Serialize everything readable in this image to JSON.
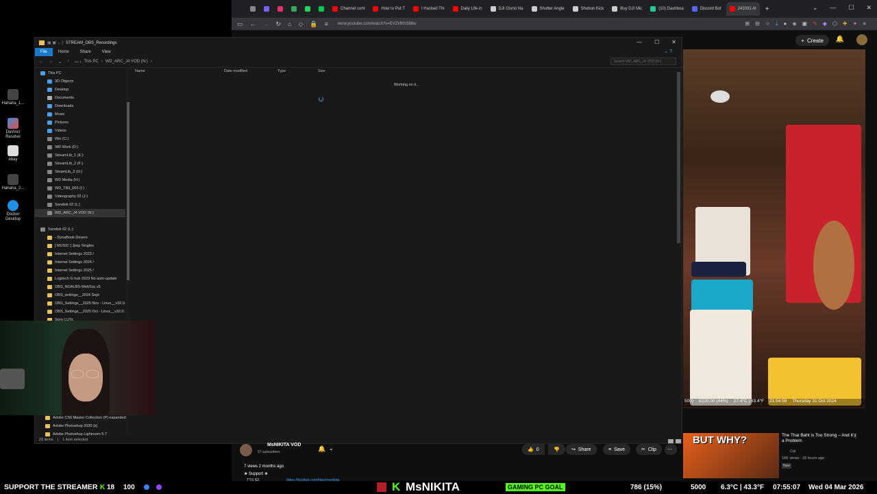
{
  "desktop": {
    "icons": [
      {
        "label": "Hahaha_1..."
      },
      {
        "label": "DaVinci Resolve"
      },
      {
        "label": "ebay"
      },
      {
        "label": "Hahaha_2..."
      },
      {
        "label": "Docker Desktop"
      }
    ]
  },
  "browser": {
    "tabs": [
      {
        "label": "",
        "color": "#888"
      },
      {
        "label": "",
        "color": "#7c5cff"
      },
      {
        "label": "",
        "color": "#e1306c"
      },
      {
        "label": "",
        "color": "#34a853"
      },
      {
        "label": "",
        "color": "#1ed760"
      },
      {
        "label": "",
        "color": "#00c853"
      },
      {
        "label": "Channel cont",
        "color": "#ff0000"
      },
      {
        "label": "How to Put T",
        "color": "#ff0000"
      },
      {
        "label": "I Hacked Thi",
        "color": "#ff0000"
      },
      {
        "label": "Daily Life in",
        "color": "#ff0000"
      },
      {
        "label": "DJI Osmo Na",
        "color": "#ccc"
      },
      {
        "label": "Shutter Angle",
        "color": "#ccc"
      },
      {
        "label": "Shobon Kick",
        "color": "#ccc"
      },
      {
        "label": "Buy DJI Mic",
        "color": "#ccc"
      },
      {
        "label": "(10) Dashboa",
        "color": "#20c997"
      },
      {
        "label": "Discord Bot",
        "color": "#5865f2"
      },
      {
        "label": "241031 At",
        "color": "#ff0000"
      }
    ],
    "url": "www.youtube.com/watch?v=EVZkfKhS86w",
    "create_label": "Create"
  },
  "explorer": {
    "title": "STREAM_OBS_Recordings",
    "ribbon": [
      "File",
      "Home",
      "Share",
      "View"
    ],
    "breadcrumb": [
      "This PC",
      "WD_ARC_J4 VOD (N:)"
    ],
    "search_placeholder": "Search WD_ARC_J4 VOD (N:)",
    "nav_items": [
      {
        "label": "This PC",
        "color": "#4a9fe8",
        "indent": 0
      },
      {
        "label": "3D Objects",
        "color": "#4a9fe8",
        "indent": 1
      },
      {
        "label": "Desktop",
        "color": "#4a9fe8",
        "indent": 1
      },
      {
        "label": "Documents",
        "color": "#aaa",
        "indent": 1
      },
      {
        "label": "Downloads",
        "color": "#4a9fe8",
        "indent": 1
      },
      {
        "label": "Music",
        "color": "#4a9fe8",
        "indent": 1
      },
      {
        "label": "Pictures",
        "color": "#4a9fe8",
        "indent": 1
      },
      {
        "label": "Videos",
        "color": "#4a9fe8",
        "indent": 1
      },
      {
        "label": "Win (C:)",
        "color": "#888",
        "indent": 1
      },
      {
        "label": "980 Work (D:)",
        "color": "#888",
        "indent": 1
      },
      {
        "label": "StreamLib_1 (E:)",
        "color": "#888",
        "indent": 1
      },
      {
        "label": "StreamLib_2 (F:)",
        "color": "#888",
        "indent": 1
      },
      {
        "label": "SteamLib_3 (G:)",
        "color": "#888",
        "indent": 1
      },
      {
        "label": "WD Media (H:)",
        "color": "#888",
        "indent": 1
      },
      {
        "label": "WD_TB3_003 (I:)",
        "color": "#888",
        "indent": 1
      },
      {
        "label": "Videography 02 (J:)",
        "color": "#888",
        "indent": 1
      },
      {
        "label": "Sandisk 02 (L:)",
        "color": "#888",
        "indent": 1
      },
      {
        "label": "WD_ARC_J4 VOD (N:)",
        "color": "#888",
        "indent": 1,
        "selected": true
      },
      {
        "label": "",
        "color": "",
        "indent": 0
      },
      {
        "label": "Sandisk 02 (L:)",
        "color": "#888",
        "indent": 0
      },
      {
        "label": "- DynaBook Drivers",
        "color": "#e8c15a",
        "indent": 1
      },
      {
        "label": "[ MUSIC ] Jpop Singles",
        "color": "#e8c15a",
        "indent": 1
      },
      {
        "label": "Internet Settings 2023 /",
        "color": "#e8c15a",
        "indent": 1
      },
      {
        "label": "Internet Settings 2024 /",
        "color": "#e8c15a",
        "indent": 1
      },
      {
        "label": "Internet Settings 2025 /",
        "color": "#e8c15a",
        "indent": 1
      },
      {
        "label": "Logitech G hub 2023 No auto-update",
        "color": "#e8c15a",
        "indent": 1
      },
      {
        "label": "OBS_NOALBS-WebSoc v5",
        "color": "#e8c15a",
        "indent": 1
      },
      {
        "label": "OBS_settings__2024 Sept",
        "color": "#e8c15a",
        "indent": 1
      },
      {
        "label": "OBS_Settings__2025 Nov - Linux__v32.0...",
        "color": "#e8c15a",
        "indent": 1
      },
      {
        "label": "OBS_Settings__2025 Oct - Linux__v32.0.1",
        "color": "#e8c15a",
        "indent": 1
      },
      {
        "label": "Sony LUTs",
        "color": "#e8c15a",
        "indent": 1
      }
    ],
    "nav_bottom": [
      {
        "label": "Adobe CS6 Master Collection (P) expanded",
        "color": "#e8c15a"
      },
      {
        "label": "Adobe Photoshop 2020 (k)",
        "color": "#e8c15a"
      },
      {
        "label": "Adobe Photoshop Lightroom 5.7",
        "color": "#e8c15a"
      }
    ],
    "columns": [
      "Name",
      "Date modified",
      "Type",
      "Size"
    ],
    "working": "Working on it...",
    "status_items": "23 items",
    "status_selected": "1 item selected"
  },
  "video_overlay": {
    "left": "500)",
    "amount": "£220.00 (44%)",
    "temp": "17.4°C | 63.4°F",
    "time": "21:54:59",
    "date": "Thursday 31 Oct 2024"
  },
  "youtube": {
    "channel": "MsNIKITA VOD",
    "subscribers": "57 subscribers",
    "likes": "0",
    "share": "Share",
    "save": "Save",
    "clip": "Clip",
    "views": "7 views  2 months ago",
    "support": "★ Support ★",
    "tts": "TTS $3",
    "link": "https://kickbot.com/tips/msnikita",
    "rec_title": "The Thai Baht is Too Strong – And it's a Problem",
    "rec_channel": "Cal",
    "rec_meta": "16K views · 15 hours ago",
    "rec_badge": "New",
    "rec_thumb_text": "BUT WHY?"
  },
  "bottombar": {
    "support": "SUPPORT THE STREAMER",
    "kick_count": "18",
    "number": "100",
    "brand": "MsNIKITA",
    "goal": "GAMING PC GOAL",
    "goal_value": "786 (15%)",
    "amount": "5000",
    "weather": "6.3°C | 43.3°F",
    "clock": "07:55:07",
    "date": "Wed 04 Mar 2026"
  }
}
